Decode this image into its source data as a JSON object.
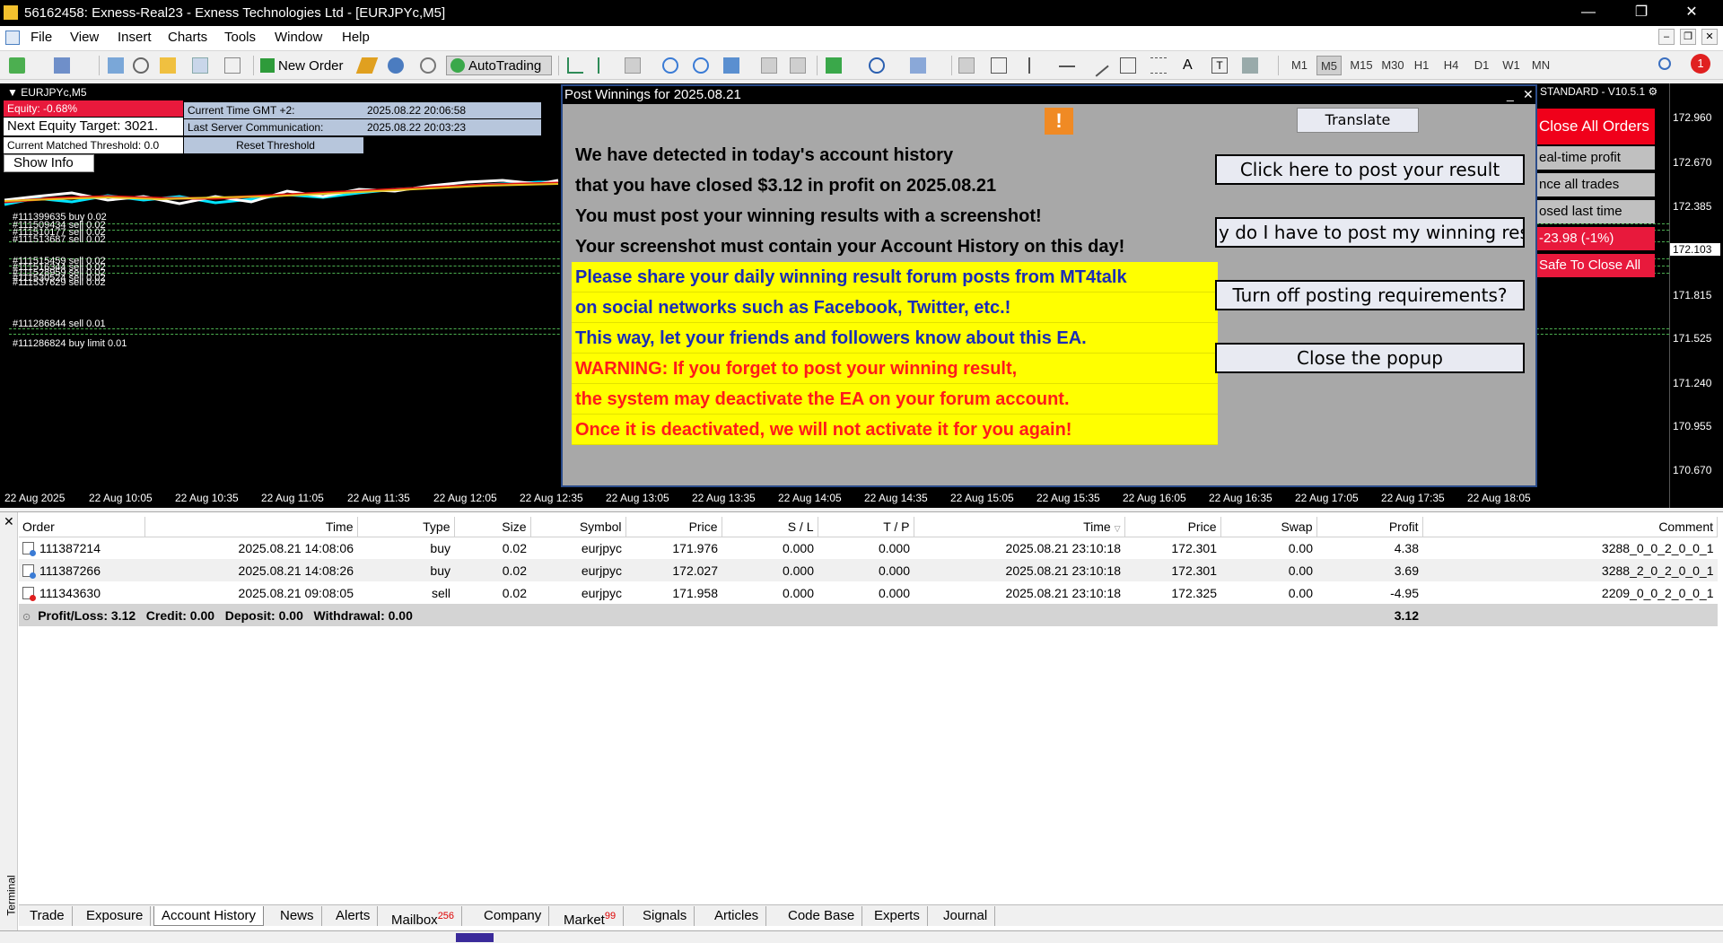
{
  "window": {
    "title": "56162458: Exness-Real23 - Exness Technologies Ltd - [EURJPYc,M5]"
  },
  "menu": [
    "File",
    "View",
    "Insert",
    "Charts",
    "Tools",
    "Window",
    "Help"
  ],
  "toolbar": {
    "new_order": "New Order",
    "autotrading": "AutoTrading",
    "timeframes": [
      "M1",
      "M5",
      "M15",
      "M30",
      "H1",
      "H4",
      "D1",
      "W1",
      "MN"
    ],
    "active_timeframe": "M5",
    "notifications": "1"
  },
  "chart": {
    "symbol_label": "EURJPYc,M5",
    "equity": "Equity: -0.68%",
    "next_target": "Next Equity Target: 3021.",
    "matched_threshold": "Current Matched Threshold: 0.0",
    "show_info": "Show Info",
    "gmt_label": "Current Time GMT +2:",
    "gmt_value": "2025.08.22 20:06:58",
    "server_label": "Last Server Communication:",
    "server_value": "2025.08.22 20:03:23",
    "reset_threshold": "Reset Threshold",
    "ea_version": "STANDARD - V10.5.1",
    "close_all_orders": "Close All Orders",
    "realtime_profit": "eal-time profit",
    "balance_trades": "nce all trades",
    "closed_last": "osed last time",
    "loss_value": "-23.98 (-1%)",
    "safe_close": "Safe To Close All",
    "price_labels": [
      "172.960",
      "172.670",
      "172.385",
      "172.103",
      "171.815",
      "171.525",
      "171.240",
      "170.955",
      "170.670"
    ],
    "current_price": "172.103",
    "time_labels": [
      "22 Aug 2025",
      "22 Aug 10:05",
      "22 Aug 10:35",
      "22 Aug 11:05",
      "22 Aug 11:35",
      "22 Aug 12:05",
      "22 Aug 12:35",
      "22 Aug 13:05",
      "22 Aug 13:35",
      "22 Aug 14:05",
      "22 Aug 14:35",
      "22 Aug 15:05",
      "22 Aug 15:35",
      "22 Aug 16:05",
      "22 Aug 16:35",
      "22 Aug 17:05",
      "22 Aug 17:35",
      "22 Aug 18:05"
    ],
    "order_labels": [
      "#111399635 buy 0.02",
      "#111509434 sell 0.02",
      "#111510177 sell 0.02",
      "#111513687 sell 0.02",
      "#111515459 sell 0.02",
      "#111516344 sell 0.02",
      "#111528959 sell 0.02",
      "#111530524 sell 0.02",
      "#111537629 sell 0.02",
      "#111286844 sell 0.01",
      "#111286824 buy limit 0.01"
    ],
    "colors": {
      "equity_bg": "#e8193c",
      "info_bg": "#b7c6dc",
      "close_btn": "#f0001a"
    }
  },
  "popup": {
    "title": "Post Winnings for 2025.08.21",
    "translate": "Translate",
    "lines": [
      "We have detected in today's account history",
      "that you have closed $3.12 in profit on 2025.08.21",
      "You must post your winning results with a screenshot!",
      "Your screenshot must contain your Account History on this day!",
      "Please share your daily winning result forum posts from MT4talk",
      "on social networks such as Facebook, Twitter, etc.!",
      "This way, let your friends and followers know about this EA.",
      "WARNING: If you forget to post your winning result,",
      "the system may deactivate the EA on your forum account.",
      "Once it is deactivated, we will not activate it for you again!"
    ],
    "buttons": {
      "post_result": "Click here to post your result",
      "why_post": "y do I have to post my winning resu",
      "turn_off": "Turn off posting requirements?",
      "close": "Close the popup"
    }
  },
  "history": {
    "columns": [
      "Order",
      "Time",
      "Type",
      "Size",
      "Symbol",
      "Price",
      "S / L",
      "T / P",
      "Time",
      "Price",
      "Swap",
      "Profit",
      "Comment"
    ],
    "rows": [
      {
        "order": "111387214",
        "open_time": "2025.08.21 14:08:06",
        "type": "buy",
        "size": "0.02",
        "symbol": "eurjpyc",
        "open_price": "171.976",
        "sl": "0.000",
        "tp": "0.000",
        "close_time": "2025.08.21 23:10:18",
        "close_price": "172.301",
        "swap": "0.00",
        "profit": "4.38",
        "comment": "3288_0_0_2_0_0_1"
      },
      {
        "order": "111387266",
        "open_time": "2025.08.21 14:08:26",
        "type": "buy",
        "size": "0.02",
        "symbol": "eurjpyc",
        "open_price": "172.027",
        "sl": "0.000",
        "tp": "0.000",
        "close_time": "2025.08.21 23:10:18",
        "close_price": "172.301",
        "swap": "0.00",
        "profit": "3.69",
        "comment": "3288_2_0_2_0_0_1"
      },
      {
        "order": "111343630",
        "open_time": "2025.08.21 09:08:05",
        "type": "sell",
        "size": "0.02",
        "symbol": "eurjpyc",
        "open_price": "171.958",
        "sl": "0.000",
        "tp": "0.000",
        "close_time": "2025.08.21 23:10:18",
        "close_price": "172.325",
        "swap": "0.00",
        "profit": "-4.95",
        "comment": "2209_0_0_2_0_0_1"
      }
    ],
    "summary": {
      "text": "Profit/Loss: 3.12   Credit: 0.00   Deposit: 0.00   Withdrawal: 0.00",
      "profit": "3.12"
    }
  },
  "terminal": {
    "side_label": "Terminal",
    "tabs": [
      {
        "label": "Trade"
      },
      {
        "label": "Exposure"
      },
      {
        "label": "Account History"
      },
      {
        "label": "News"
      },
      {
        "label": "Alerts"
      },
      {
        "label": "Mailbox",
        "badge": "256"
      },
      {
        "label": "Company"
      },
      {
        "label": "Market",
        "badge": "99"
      },
      {
        "label": "Signals"
      },
      {
        "label": "Articles"
      },
      {
        "label": "Code Base"
      },
      {
        "label": "Experts"
      },
      {
        "label": "Journal"
      }
    ],
    "active_tab": "Account History"
  }
}
